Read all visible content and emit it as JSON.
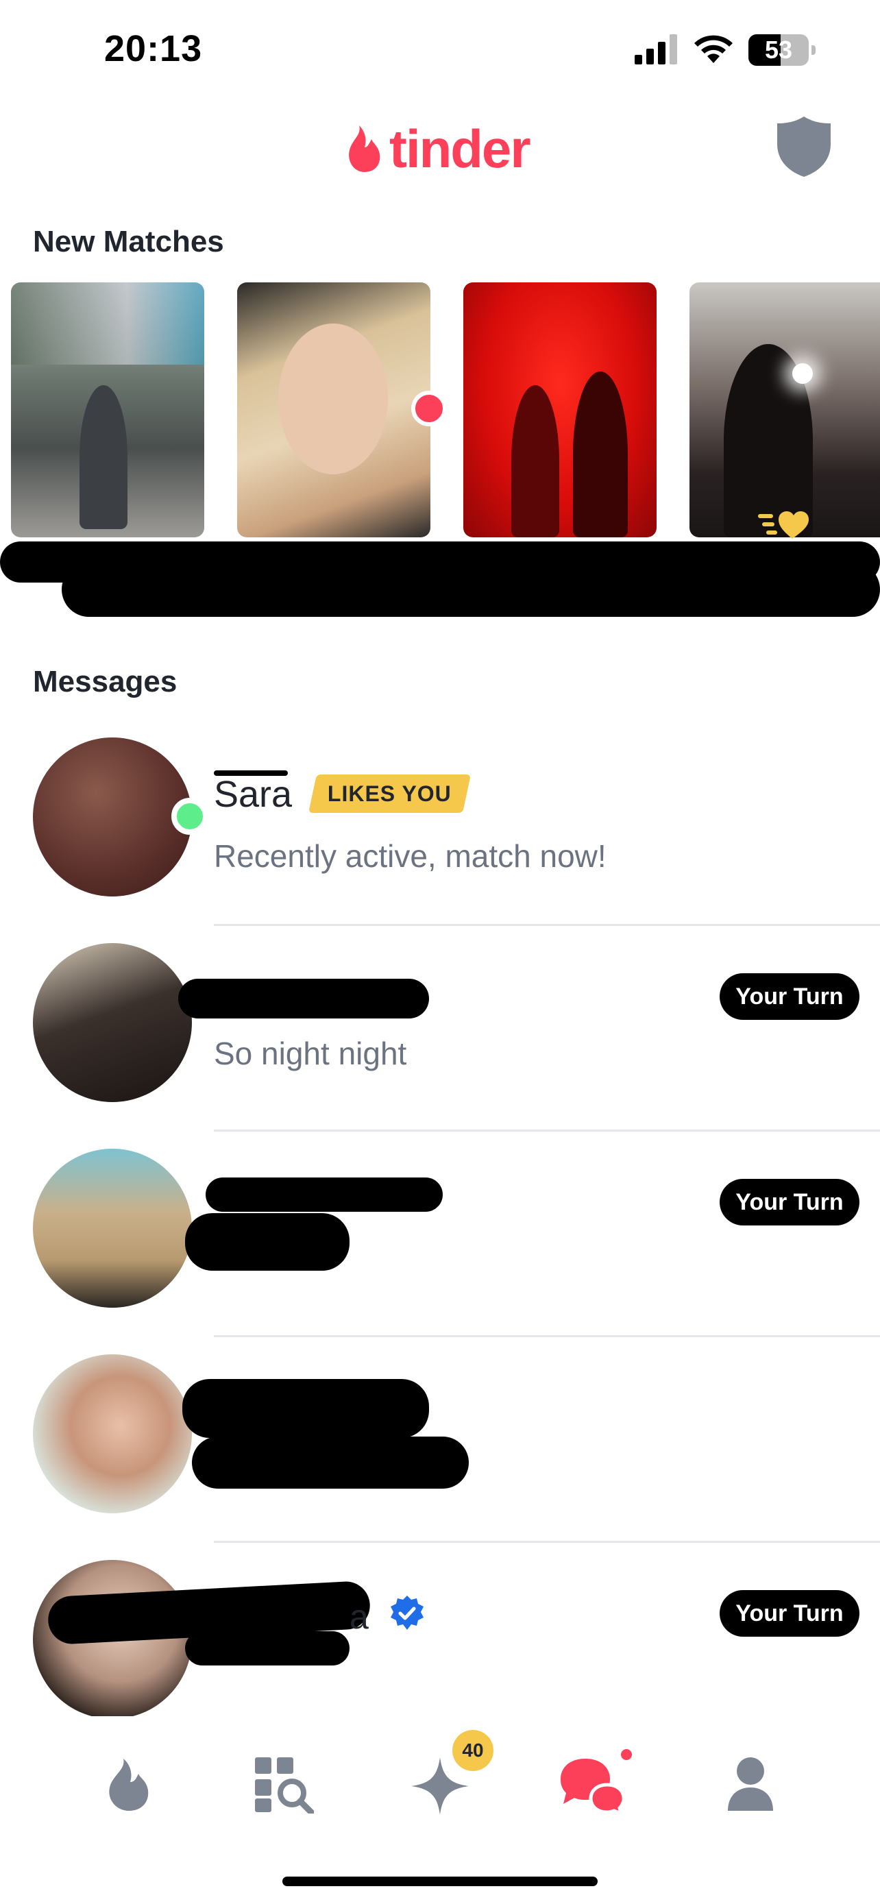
{
  "status_bar": {
    "time": "20:13",
    "battery": "53",
    "battery_level": 0.53
  },
  "header": {
    "logo_text": "tinder"
  },
  "new_matches": {
    "title": "New Matches"
  },
  "messages": {
    "title": "Messages",
    "items": [
      {
        "name": "Sara",
        "badge": "LIKES YOU",
        "preview": "Recently active, match now!",
        "online": true
      },
      {
        "name": "",
        "preview": "So night night",
        "action": "Your Turn"
      },
      {
        "name": "",
        "preview": "",
        "action": "Your Turn"
      },
      {
        "name": "",
        "preview": ""
      },
      {
        "name_tail": "a",
        "verified": true,
        "action": "Your Turn"
      }
    ]
  },
  "nav": {
    "tabs": [
      "flame-icon",
      "explore-icon",
      "sparkle-icon",
      "chat-icon",
      "profile-icon"
    ],
    "sparkle_badge": "40",
    "active_tab": "chat-icon"
  },
  "colors": {
    "brand": "#fd4059",
    "badge_gold": "#f5c84b",
    "online_green": "#5ded8a",
    "icon_gray": "#7c8591"
  }
}
